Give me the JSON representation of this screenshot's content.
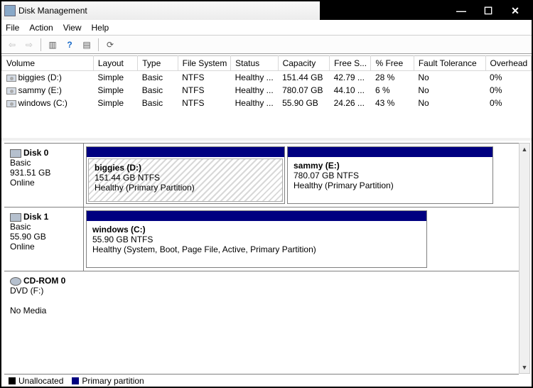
{
  "window": {
    "title": "Disk Management"
  },
  "menu": {
    "file": "File",
    "action": "Action",
    "view": "View",
    "help": "Help"
  },
  "columns": {
    "volume": "Volume",
    "layout": "Layout",
    "type": "Type",
    "fs": "File System",
    "status": "Status",
    "capacity": "Capacity",
    "free": "Free S...",
    "pctfree": "% Free",
    "fault": "Fault Tolerance",
    "overhead": "Overhead"
  },
  "volumes": [
    {
      "name": "biggies (D:)",
      "layout": "Simple",
      "type": "Basic",
      "fs": "NTFS",
      "status": "Healthy ...",
      "capacity": "151.44 GB",
      "free": "42.79 ...",
      "pctfree": "28 %",
      "fault": "No",
      "overhead": "0%"
    },
    {
      "name": "sammy (E:)",
      "layout": "Simple",
      "type": "Basic",
      "fs": "NTFS",
      "status": "Healthy ...",
      "capacity": "780.07 GB",
      "free": "44.10 ...",
      "pctfree": "6 %",
      "fault": "No",
      "overhead": "0%"
    },
    {
      "name": "windows (C:)",
      "layout": "Simple",
      "type": "Basic",
      "fs": "NTFS",
      "status": "Healthy ...",
      "capacity": "55.90 GB",
      "free": "24.26 ...",
      "pctfree": "43 %",
      "fault": "No",
      "overhead": "0%"
    }
  ],
  "disks": {
    "d0": {
      "name": "Disk 0",
      "type": "Basic",
      "size": "931.51 GB",
      "status": "Online",
      "p0": {
        "name": "biggies  (D:)",
        "size": "151.44 GB NTFS",
        "status": "Healthy (Primary Partition)"
      },
      "p1": {
        "name": "sammy  (E:)",
        "size": "780.07 GB NTFS",
        "status": "Healthy (Primary Partition)"
      }
    },
    "d1": {
      "name": "Disk 1",
      "type": "Basic",
      "size": "55.90 GB",
      "status": "Online",
      "p0": {
        "name": "windows  (C:)",
        "size": "55.90 GB NTFS",
        "status": "Healthy (System, Boot, Page File, Active, Primary Partition)"
      }
    },
    "cd": {
      "name": "CD-ROM 0",
      "type": "DVD (F:)",
      "status": "No Media"
    }
  },
  "legend": {
    "unalloc": "Unallocated",
    "primary": "Primary partition"
  }
}
